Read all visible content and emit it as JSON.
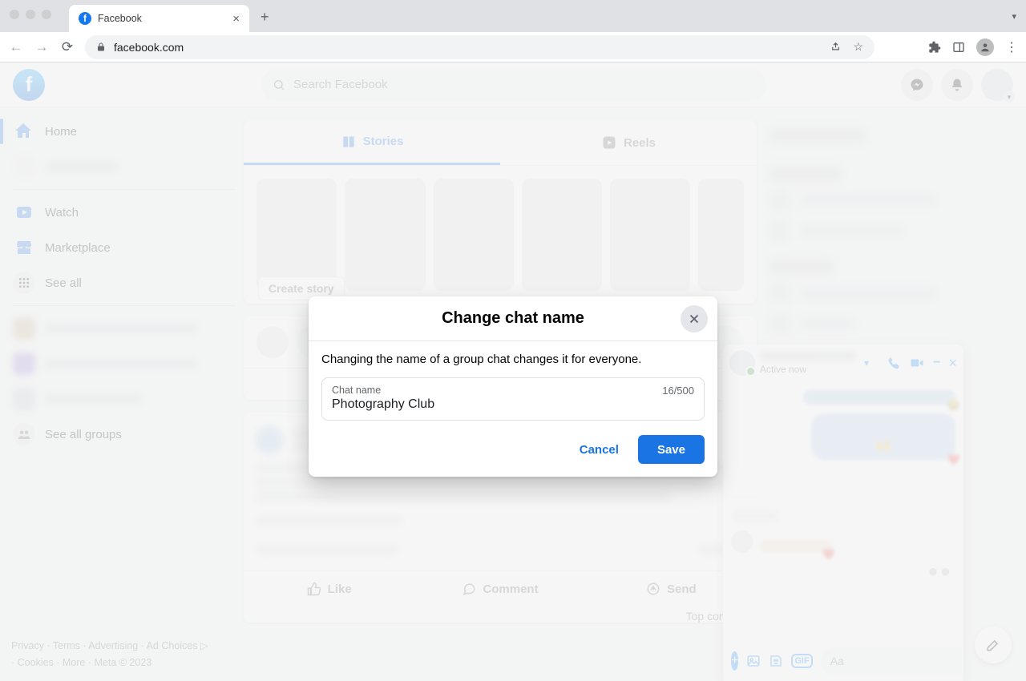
{
  "browser": {
    "tab_title": "Facebook",
    "url": "facebook.com",
    "new_tab": "+"
  },
  "header": {
    "search_placeholder": "Search Facebook"
  },
  "sidebar": {
    "items": [
      {
        "label": "Home"
      },
      {
        "label": ""
      },
      {
        "label": "Watch"
      },
      {
        "label": "Marketplace"
      },
      {
        "label": "See all"
      }
    ],
    "see_all_groups": "See all groups"
  },
  "footer": {
    "line1": "Privacy · Terms · Advertising · Ad Choices ▷",
    "line2": "· Cookies · More · Meta © 2023"
  },
  "stories": {
    "tab_stories": "Stories",
    "tab_reels": "Reels",
    "create": "Create story"
  },
  "post_actions": {
    "like": "Like",
    "comment": "Comment",
    "send": "Send",
    "top_comments": "Top comme"
  },
  "chat": {
    "status": "Active now",
    "input_placeholder": "Aa",
    "gif": "GIF"
  },
  "modal": {
    "title": "Change chat name",
    "message": "Changing the name of a group chat changes it for everyone.",
    "field_label": "Chat name",
    "field_value": "Photography Club",
    "counter": "16/500",
    "cancel": "Cancel",
    "save": "Save"
  }
}
